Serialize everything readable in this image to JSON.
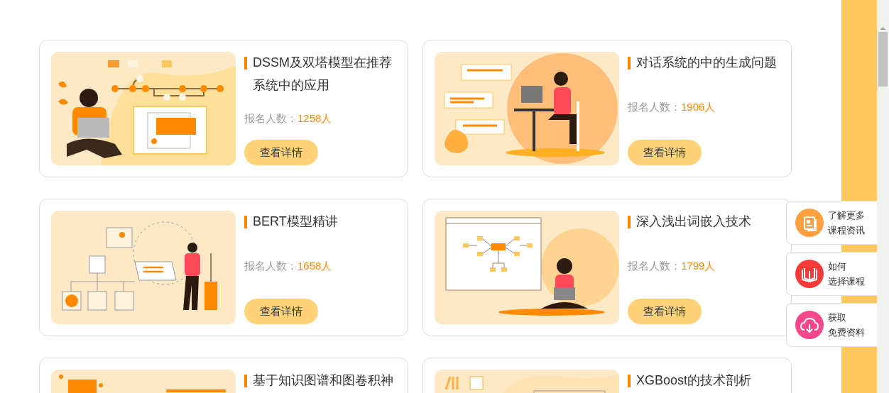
{
  "courses": [
    {
      "title": "DSSM及双塔模型在推荐系统中的应用",
      "count_label": "报名人数：",
      "count": "1258人",
      "button": "查看详情"
    },
    {
      "title": "对话系统的中的生成问题",
      "count_label": "报名人数：",
      "count": "1906人",
      "button": "查看详情"
    },
    {
      "title": "BERT模型精讲",
      "count_label": "报名人数：",
      "count": "1658人",
      "button": "查看详情"
    },
    {
      "title": "深入浅出词嵌入技术",
      "count_label": "报名人数：",
      "count": "1799人",
      "button": "查看详情"
    },
    {
      "title": "基于知识图谱和图卷积神"
    },
    {
      "title": "XGBoost的技术剖析"
    }
  ],
  "side_links": [
    {
      "lines": [
        "了解更多",
        "课程资讯"
      ],
      "color": "#ff9f3f"
    },
    {
      "lines": [
        "如何",
        "选择课程"
      ],
      "color": "#f53a3a"
    },
    {
      "lines": [
        "获取",
        "免费资料"
      ],
      "color": "#f5478a"
    }
  ]
}
